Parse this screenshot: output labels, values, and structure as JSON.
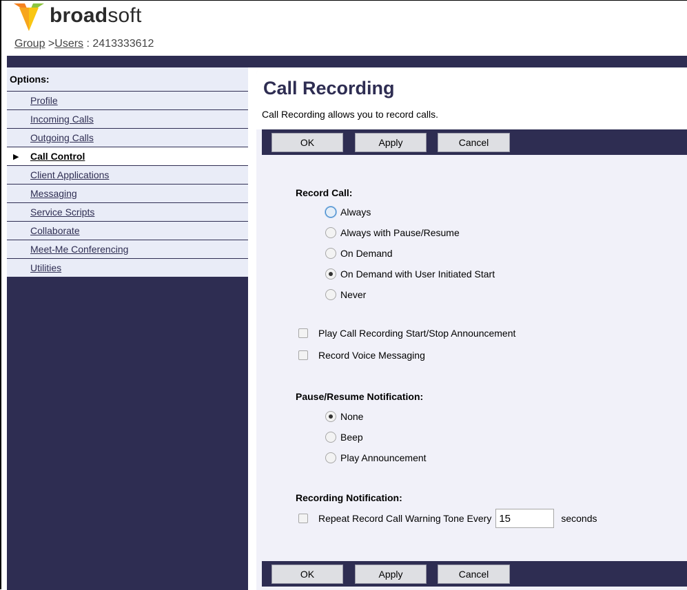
{
  "header": {
    "brand_bold": "broad",
    "brand_light": "soft",
    "breadcrumb": {
      "group": "Group",
      "sep": " >",
      "users": "Users",
      "suffix": " : 2413333612"
    }
  },
  "sidebar": {
    "title": "Options:",
    "items": [
      {
        "label": "Profile",
        "active": false
      },
      {
        "label": "Incoming Calls",
        "active": false
      },
      {
        "label": "Outgoing Calls",
        "active": false
      },
      {
        "label": "Call Control",
        "active": true
      },
      {
        "label": "Client Applications",
        "active": false
      },
      {
        "label": "Messaging",
        "active": false
      },
      {
        "label": "Service Scripts",
        "active": false
      },
      {
        "label": "Collaborate",
        "active": false
      },
      {
        "label": "Meet-Me Conferencing",
        "active": false
      },
      {
        "label": "Utilities",
        "active": false
      }
    ],
    "active_marker": "▶"
  },
  "main": {
    "title": "Call Recording",
    "description": "Call Recording allows you to record calls.",
    "buttons": {
      "ok": "OK",
      "apply": "Apply",
      "cancel": "Cancel"
    },
    "record_call": {
      "label": "Record Call:",
      "options": [
        "Always",
        "Always with Pause/Resume",
        "On Demand",
        "On Demand with User Initiated Start",
        "Never"
      ],
      "selected": "On Demand with User Initiated Start"
    },
    "checkboxes": {
      "play_announcement": "Play Call Recording Start/Stop Announcement",
      "record_voice_messaging": "Record Voice Messaging"
    },
    "pause_resume": {
      "label": "Pause/Resume Notification:",
      "options": [
        "None",
        "Beep",
        "Play Announcement"
      ],
      "selected": "None"
    },
    "recording_notification": {
      "label": "Recording Notification:",
      "repeat_label": "Repeat Record Call Warning Tone Every",
      "interval_value": "15",
      "unit": "seconds"
    }
  },
  "colors": {
    "navy": "#2e2d52",
    "panel": "#f1f1f9",
    "logo_orange": "#f58220",
    "logo_yellow": "#f9c612",
    "logo_green": "#8cc63f"
  }
}
